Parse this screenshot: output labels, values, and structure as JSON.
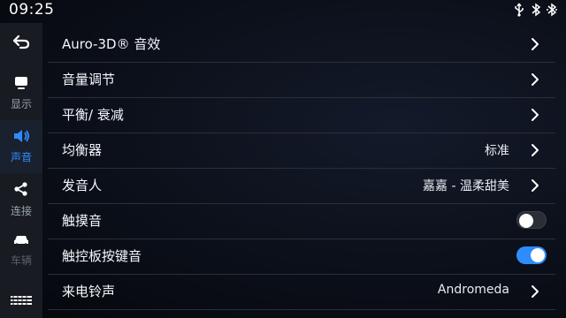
{
  "status": {
    "time": "09:25",
    "icons": [
      "usb-icon",
      "bluetooth-icon",
      "bluetooth-connected-icon"
    ]
  },
  "sidebar": {
    "back_icon": "back-arrow-icon",
    "items": [
      {
        "label": "显示",
        "icon": "display-icon",
        "active": false
      },
      {
        "label": "声音",
        "icon": "speaker-icon",
        "active": true
      },
      {
        "label": "连接",
        "icon": "share-icon",
        "active": false
      },
      {
        "label": "车辆",
        "icon": "car-icon",
        "active": false
      }
    ],
    "bottom_icon": "grid-menu-icon"
  },
  "settings": [
    {
      "title": "Auro-3D® 音效",
      "value": "",
      "control": "chevron"
    },
    {
      "title": "音量调节",
      "value": "",
      "control": "chevron"
    },
    {
      "title": "平衡/ 衰减",
      "value": "",
      "control": "chevron"
    },
    {
      "title": "均衡器",
      "value": "标准",
      "control": "chevron"
    },
    {
      "title": "发音人",
      "value": "嘉嘉 - 温柔甜美",
      "control": "chevron"
    },
    {
      "title": "触摸音",
      "value": "",
      "control": "toggle",
      "on": false
    },
    {
      "title": "触控板按键音",
      "value": "",
      "control": "toggle",
      "on": true
    },
    {
      "title": "来电铃声",
      "value": "Andromeda",
      "control": "chevron"
    }
  ],
  "colors": {
    "accent": "#2f8cff",
    "background": "#0b0f19",
    "divider": "#2a2f38"
  }
}
